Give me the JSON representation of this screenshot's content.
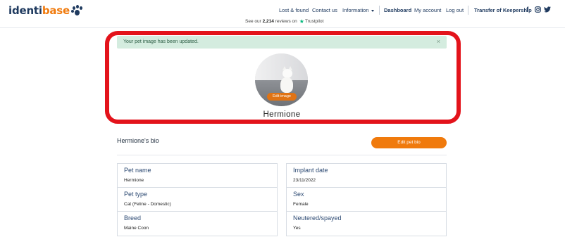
{
  "header": {
    "logo": {
      "part1": "identi",
      "part2": "base"
    },
    "nav": {
      "lost_found": "Lost & found",
      "contact": "Contact us",
      "information": "Information",
      "dashboard": "Dashboard",
      "my_account": "My account",
      "log_out": "Log out",
      "transfer": "Transfer of Keepership"
    },
    "social": {
      "facebook": "f",
      "instagram": "◎",
      "twitter": "🐦"
    },
    "trustpilot": {
      "prefix": "See our",
      "count": "2,214",
      "suffix": "reviews on",
      "brand": "Trustpilot"
    }
  },
  "alert": {
    "message": "Your pet image has been updated.",
    "close": "×"
  },
  "profile": {
    "edit_image": "Edit image",
    "name": "Hermione"
  },
  "bio": {
    "title": "Hermione's bio",
    "edit_button": "Edit pet bio",
    "left": [
      {
        "label": "Pet name",
        "value": "Hermione"
      },
      {
        "label": "Pet type",
        "value": "Cat (Feline - Domestic)"
      },
      {
        "label": "Breed",
        "value": "Maine Coon"
      }
    ],
    "right": [
      {
        "label": "Implant date",
        "value": "23/11/2022"
      },
      {
        "label": "Sex",
        "value": "Female"
      },
      {
        "label": "Neutered/spayed",
        "value": "Yes"
      }
    ]
  },
  "colors": {
    "brand_navy": "#1f3a5f",
    "brand_orange": "#f07a0c",
    "highlight_red": "#e3131b",
    "alert_green": "#d4ecdf"
  }
}
